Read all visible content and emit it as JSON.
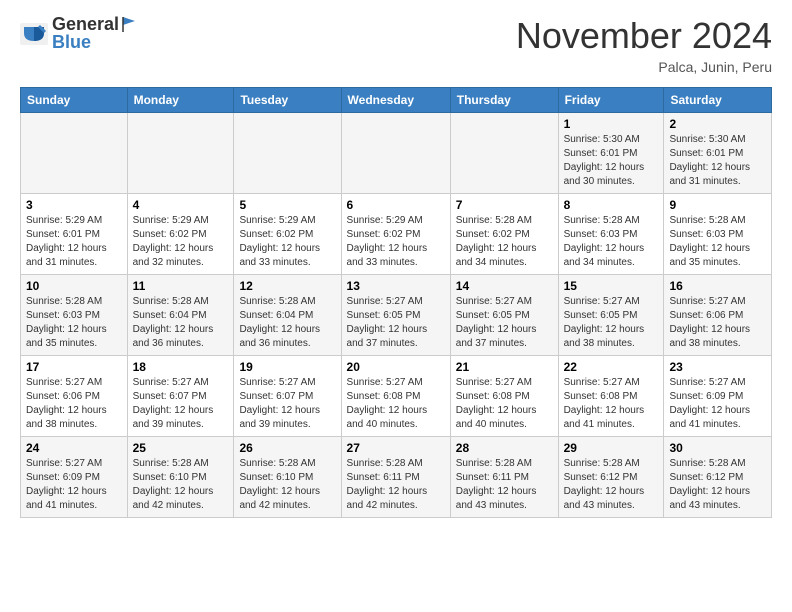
{
  "header": {
    "logo_general": "General",
    "logo_blue": "Blue",
    "month_title": "November 2024",
    "location": "Palca, Junin, Peru"
  },
  "days_of_week": [
    "Sunday",
    "Monday",
    "Tuesday",
    "Wednesday",
    "Thursday",
    "Friday",
    "Saturday"
  ],
  "weeks": [
    [
      {
        "day": "",
        "info": ""
      },
      {
        "day": "",
        "info": ""
      },
      {
        "day": "",
        "info": ""
      },
      {
        "day": "",
        "info": ""
      },
      {
        "day": "",
        "info": ""
      },
      {
        "day": "1",
        "info": "Sunrise: 5:30 AM\nSunset: 6:01 PM\nDaylight: 12 hours and 30 minutes."
      },
      {
        "day": "2",
        "info": "Sunrise: 5:30 AM\nSunset: 6:01 PM\nDaylight: 12 hours and 31 minutes."
      }
    ],
    [
      {
        "day": "3",
        "info": "Sunrise: 5:29 AM\nSunset: 6:01 PM\nDaylight: 12 hours and 31 minutes."
      },
      {
        "day": "4",
        "info": "Sunrise: 5:29 AM\nSunset: 6:02 PM\nDaylight: 12 hours and 32 minutes."
      },
      {
        "day": "5",
        "info": "Sunrise: 5:29 AM\nSunset: 6:02 PM\nDaylight: 12 hours and 33 minutes."
      },
      {
        "day": "6",
        "info": "Sunrise: 5:29 AM\nSunset: 6:02 PM\nDaylight: 12 hours and 33 minutes."
      },
      {
        "day": "7",
        "info": "Sunrise: 5:28 AM\nSunset: 6:02 PM\nDaylight: 12 hours and 34 minutes."
      },
      {
        "day": "8",
        "info": "Sunrise: 5:28 AM\nSunset: 6:03 PM\nDaylight: 12 hours and 34 minutes."
      },
      {
        "day": "9",
        "info": "Sunrise: 5:28 AM\nSunset: 6:03 PM\nDaylight: 12 hours and 35 minutes."
      }
    ],
    [
      {
        "day": "10",
        "info": "Sunrise: 5:28 AM\nSunset: 6:03 PM\nDaylight: 12 hours and 35 minutes."
      },
      {
        "day": "11",
        "info": "Sunrise: 5:28 AM\nSunset: 6:04 PM\nDaylight: 12 hours and 36 minutes."
      },
      {
        "day": "12",
        "info": "Sunrise: 5:28 AM\nSunset: 6:04 PM\nDaylight: 12 hours and 36 minutes."
      },
      {
        "day": "13",
        "info": "Sunrise: 5:27 AM\nSunset: 6:05 PM\nDaylight: 12 hours and 37 minutes."
      },
      {
        "day": "14",
        "info": "Sunrise: 5:27 AM\nSunset: 6:05 PM\nDaylight: 12 hours and 37 minutes."
      },
      {
        "day": "15",
        "info": "Sunrise: 5:27 AM\nSunset: 6:05 PM\nDaylight: 12 hours and 38 minutes."
      },
      {
        "day": "16",
        "info": "Sunrise: 5:27 AM\nSunset: 6:06 PM\nDaylight: 12 hours and 38 minutes."
      }
    ],
    [
      {
        "day": "17",
        "info": "Sunrise: 5:27 AM\nSunset: 6:06 PM\nDaylight: 12 hours and 38 minutes."
      },
      {
        "day": "18",
        "info": "Sunrise: 5:27 AM\nSunset: 6:07 PM\nDaylight: 12 hours and 39 minutes."
      },
      {
        "day": "19",
        "info": "Sunrise: 5:27 AM\nSunset: 6:07 PM\nDaylight: 12 hours and 39 minutes."
      },
      {
        "day": "20",
        "info": "Sunrise: 5:27 AM\nSunset: 6:08 PM\nDaylight: 12 hours and 40 minutes."
      },
      {
        "day": "21",
        "info": "Sunrise: 5:27 AM\nSunset: 6:08 PM\nDaylight: 12 hours and 40 minutes."
      },
      {
        "day": "22",
        "info": "Sunrise: 5:27 AM\nSunset: 6:08 PM\nDaylight: 12 hours and 41 minutes."
      },
      {
        "day": "23",
        "info": "Sunrise: 5:27 AM\nSunset: 6:09 PM\nDaylight: 12 hours and 41 minutes."
      }
    ],
    [
      {
        "day": "24",
        "info": "Sunrise: 5:27 AM\nSunset: 6:09 PM\nDaylight: 12 hours and 41 minutes."
      },
      {
        "day": "25",
        "info": "Sunrise: 5:28 AM\nSunset: 6:10 PM\nDaylight: 12 hours and 42 minutes."
      },
      {
        "day": "26",
        "info": "Sunrise: 5:28 AM\nSunset: 6:10 PM\nDaylight: 12 hours and 42 minutes."
      },
      {
        "day": "27",
        "info": "Sunrise: 5:28 AM\nSunset: 6:11 PM\nDaylight: 12 hours and 42 minutes."
      },
      {
        "day": "28",
        "info": "Sunrise: 5:28 AM\nSunset: 6:11 PM\nDaylight: 12 hours and 43 minutes."
      },
      {
        "day": "29",
        "info": "Sunrise: 5:28 AM\nSunset: 6:12 PM\nDaylight: 12 hours and 43 minutes."
      },
      {
        "day": "30",
        "info": "Sunrise: 5:28 AM\nSunset: 6:12 PM\nDaylight: 12 hours and 43 minutes."
      }
    ]
  ]
}
